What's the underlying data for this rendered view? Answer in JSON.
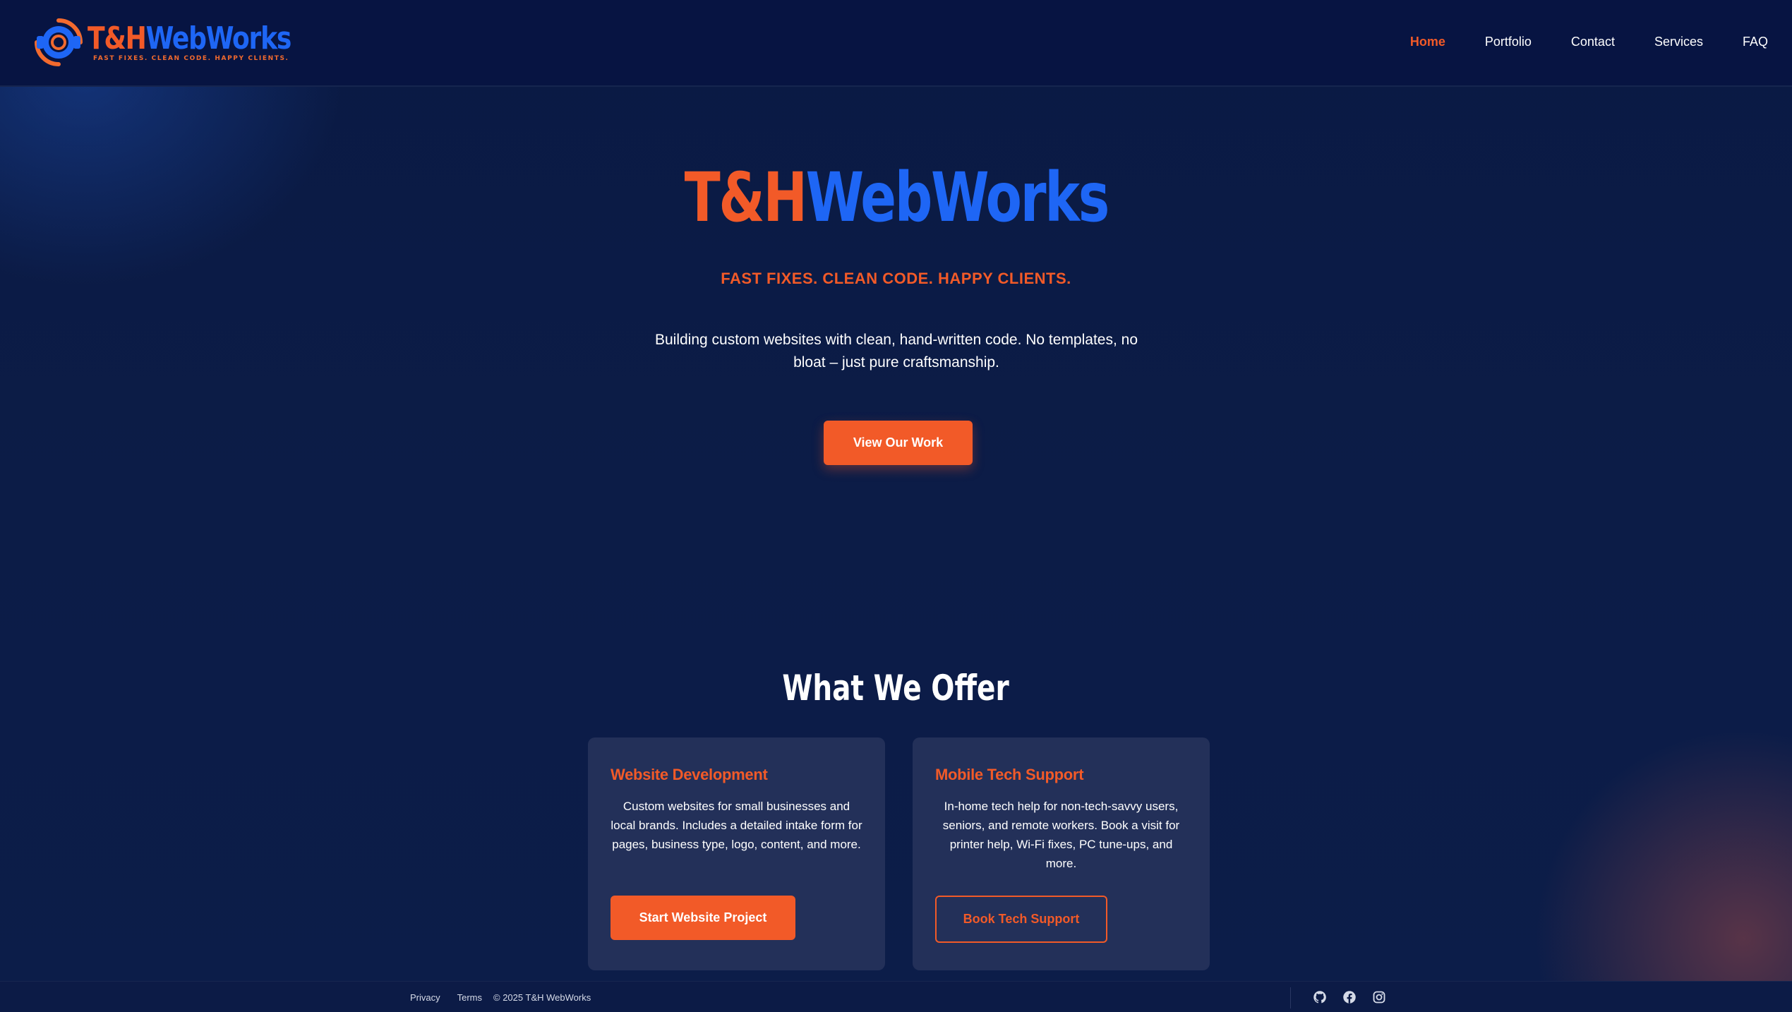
{
  "brand": {
    "name_part1": "T&H",
    "name_part2": "WebWorks",
    "tagline": "FAST FIXES. CLEAN CODE. HAPPY CLIENTS."
  },
  "colors": {
    "accent_orange": "#f25a28",
    "accent_blue": "#1e66f5",
    "background": "#0b1a42",
    "card": "#233059"
  },
  "nav": {
    "items": [
      {
        "label": "Home",
        "active": true
      },
      {
        "label": "Portfolio",
        "active": false
      },
      {
        "label": "Contact",
        "active": false
      },
      {
        "label": "Services",
        "active": false
      },
      {
        "label": "FAQ",
        "active": false
      }
    ]
  },
  "hero": {
    "title_part1": "T&H",
    "title_part2": "WebWorks",
    "tagline": "FAST FIXES. CLEAN CODE. HAPPY CLIENTS.",
    "description": "Building custom websites with clean, hand-written code. No templates, no bloat – just pure craftsmanship.",
    "cta_label": "View Our Work"
  },
  "offer": {
    "title": "What We Offer",
    "cards": [
      {
        "title": "Website Development",
        "description": "Custom websites for small businesses and local brands. Includes a detailed intake form for pages, business type, logo, content, and more.",
        "button_label": "Start Website Project"
      },
      {
        "title": "Mobile Tech Support",
        "description": "In-home tech help for non-tech-savvy users, seniors, and remote workers. Book a visit for printer help, Wi-Fi fixes, PC tune-ups, and more.",
        "button_label": "Book Tech Support"
      }
    ]
  },
  "footer": {
    "privacy_label": "Privacy",
    "terms_label": "Terms",
    "copyright": "© 2025 T&H WebWorks",
    "social_icons": [
      "github-icon",
      "facebook-icon",
      "instagram-icon"
    ]
  }
}
